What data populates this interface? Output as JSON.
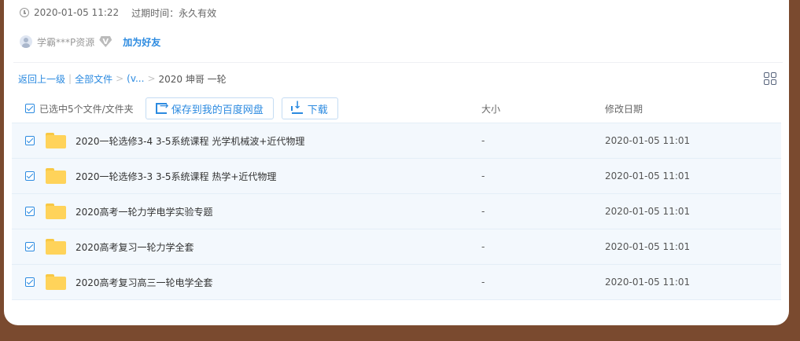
{
  "share_info": {
    "share_time": "2020-01-05 11:22",
    "expire_text": "过期时间：永久有效"
  },
  "user": {
    "name": "学霸***P资源",
    "vip_badge": "V",
    "add_friend": "加为好友"
  },
  "breadcrumb": {
    "back": "返回上一级",
    "sep_bar": "|",
    "all_files": "全部文件",
    "sep": ">",
    "middle": "(v...",
    "current": "2020 坤哥 一轮"
  },
  "toolbar": {
    "selected_text": "已选中5个文件/文件夹",
    "save_label": "保存到我的百度网盘",
    "download_label": "下载",
    "col_size": "大小",
    "col_date": "修改日期"
  },
  "files": [
    {
      "name": "2020一轮选修3-4 3-5系统课程 光学机械波+近代物理",
      "size": "-",
      "date": "2020-01-05 11:01"
    },
    {
      "name": "2020一轮选修3-3 3-5系统课程 热学+近代物理",
      "size": "-",
      "date": "2020-01-05 11:01"
    },
    {
      "name": "2020高考一轮力学电学实验专题",
      "size": "-",
      "date": "2020-01-05 11:01"
    },
    {
      "name": "2020高考复习一轮力学全套",
      "size": "-",
      "date": "2020-01-05 11:01"
    },
    {
      "name": "2020高考复习高三一轮电学全套",
      "size": "-",
      "date": "2020-01-05 11:01"
    }
  ]
}
